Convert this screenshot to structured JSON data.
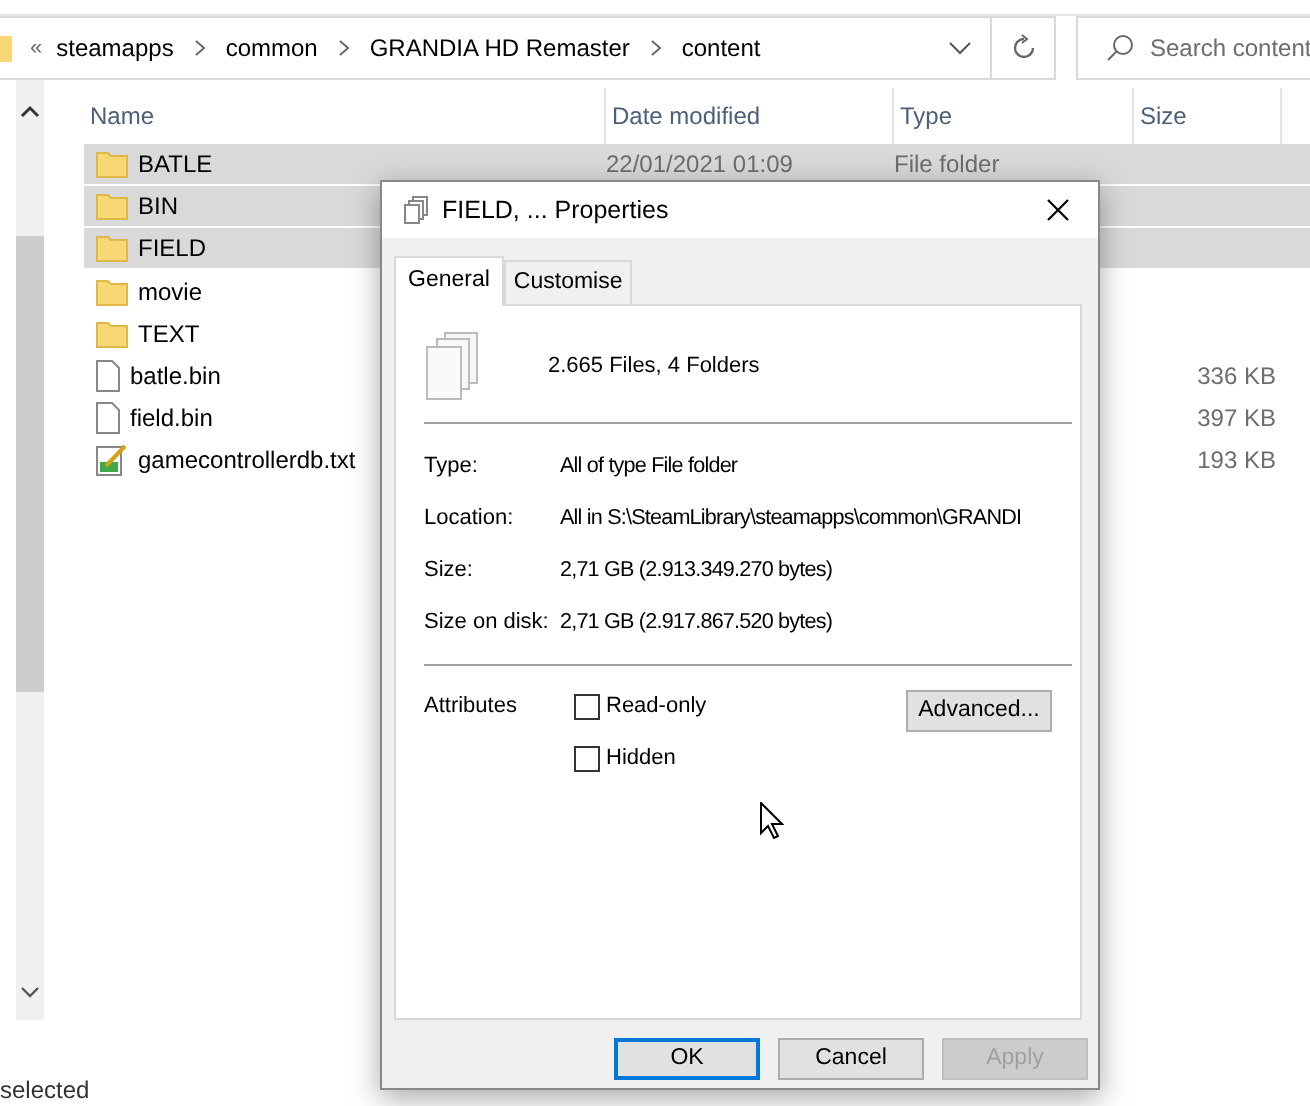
{
  "address_bar": {
    "overflow": "«",
    "crumbs": [
      "steamapps",
      "common",
      "GRANDIA HD Remaster",
      "content"
    ]
  },
  "search": {
    "placeholder": "Search content"
  },
  "columns": [
    "Name",
    "Date modified",
    "Type",
    "Size"
  ],
  "files": [
    {
      "name": "BATLE",
      "kind": "folder",
      "selected": true,
      "date": "22/01/2021 01:09",
      "type": "File folder"
    },
    {
      "name": "BIN",
      "kind": "folder",
      "selected": true
    },
    {
      "name": "FIELD",
      "kind": "folder",
      "selected": true
    },
    {
      "name": "movie",
      "kind": "folder",
      "selected": false
    },
    {
      "name": "TEXT",
      "kind": "folder",
      "selected": false
    },
    {
      "name": "batle.bin",
      "kind": "file",
      "selected": false,
      "size": "336 KB"
    },
    {
      "name": "field.bin",
      "kind": "file",
      "selected": false,
      "size": "397 KB"
    },
    {
      "name": "gamecontrollerdb.txt",
      "kind": "text",
      "selected": false,
      "size": "193 KB"
    }
  ],
  "status_bar": "selected",
  "dialog": {
    "title": "FIELD, ... Properties",
    "tabs": [
      {
        "label": "General",
        "selected": true
      },
      {
        "label": "Customise",
        "selected": false
      }
    ],
    "summary": "2.665 Files, 4 Folders",
    "properties": [
      {
        "label": "Type:",
        "value": "All of type File folder"
      },
      {
        "label": "Location:",
        "value": "All in S:\\SteamLibrary\\steamapps\\common\\GRANDI"
      },
      {
        "label": "Size:",
        "value": "2,71 GB (2.913.349.270 bytes)"
      },
      {
        "label": "Size on disk:",
        "value": "2,71 GB (2.917.867.520 bytes)"
      }
    ],
    "attributes_label": "Attributes",
    "attributes": [
      {
        "label": "Read-only",
        "checked": false
      },
      {
        "label": "Hidden",
        "checked": false
      }
    ],
    "advanced_button": "Advanced...",
    "buttons": [
      {
        "label": "OK",
        "kind": "default",
        "disabled": false
      },
      {
        "label": "Cancel",
        "kind": "normal",
        "disabled": false
      },
      {
        "label": "Apply",
        "kind": "normal",
        "disabled": true
      }
    ]
  }
}
